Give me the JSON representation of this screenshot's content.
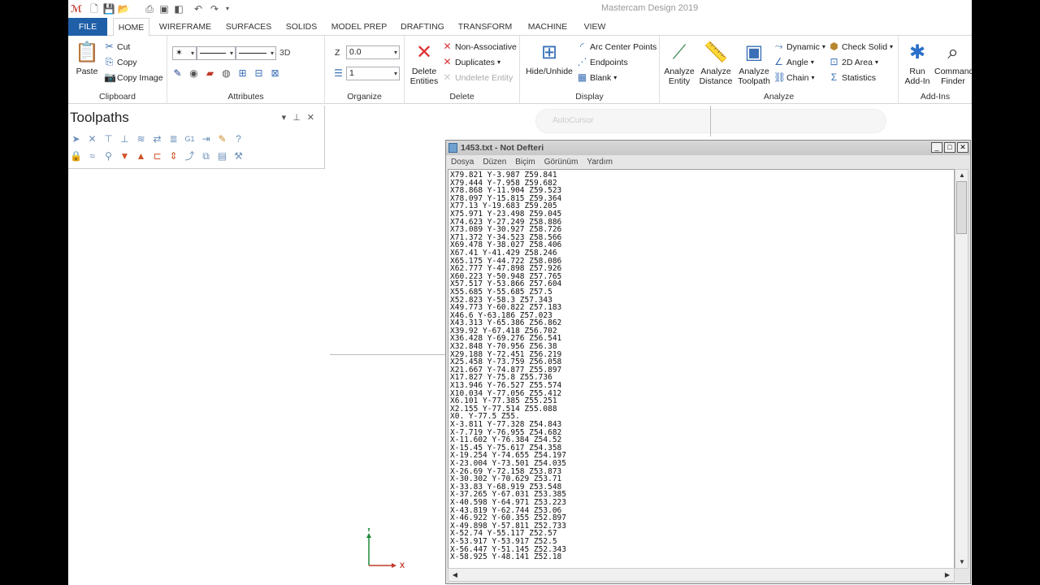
{
  "window": {
    "title": "Mastercam Design 2019"
  },
  "tabs": [
    {
      "label": "FILE"
    },
    {
      "label": "HOME"
    },
    {
      "label": "WIREFRAME"
    },
    {
      "label": "SURFACES"
    },
    {
      "label": "SOLIDS"
    },
    {
      "label": "MODEL PREP"
    },
    {
      "label": "DRAFTING"
    },
    {
      "label": "TRANSFORM"
    },
    {
      "label": "MACHINE"
    },
    {
      "label": "VIEW"
    }
  ],
  "ribbon": {
    "clipboard": {
      "label": "Clipboard",
      "paste": "Paste",
      "cut": "Cut",
      "copy": "Copy",
      "copy_image": "Copy Image"
    },
    "attributes": {
      "label": "Attributes",
      "mode_3d": "3D"
    },
    "organize": {
      "label": "Organize",
      "z_label": "Z",
      "z_value": "0.0",
      "level_value": "1"
    },
    "delete": {
      "label": "Delete",
      "delete_entities": "Delete Entities",
      "non_associative": "Non-Associative",
      "duplicates": "Duplicates",
      "undelete": "Undelete Entity"
    },
    "display": {
      "label": "Display",
      "hide_unhide": "Hide/Unhide",
      "arc_center_points": "Arc Center Points",
      "endpoints": "Endpoints",
      "blank": "Blank"
    },
    "analyze": {
      "label": "Analyze",
      "analyze_entity": "Analyze Entity",
      "analyze_distance": "Analyze Distance",
      "analyze_toolpath": "Analyze Toolpath",
      "dynamic": "Dynamic",
      "angle": "Angle",
      "chain": "Chain",
      "check_solid": "Check Solid",
      "area_2d": "2D Area",
      "statistics": "Statistics"
    },
    "addins": {
      "label": "Add-Ins",
      "run_addin": "Run Add-In",
      "command_finder": "Command Finder"
    }
  },
  "toolpaths": {
    "title": "Toolpaths"
  },
  "graphics": {
    "autocursor": "AutoCursor",
    "axis_y": "Y",
    "axis_x": "X"
  },
  "notepad": {
    "title": "1453.txt - Not Defteri",
    "menu": [
      "Dosya",
      "Düzen",
      "Biçim",
      "Görünüm",
      "Yardım"
    ],
    "lines": [
      "X79.821 Y-3.987 Z59.841",
      "X79.444 Y-7.958 Z59.682",
      "X78.868 Y-11.904 Z59.523",
      "X78.097 Y-15.815 Z59.364",
      "X77.13 Y-19.683 Z59.205",
      "X75.971 Y-23.498 Z59.045",
      "X74.623 Y-27.249 Z58.886",
      "X73.089 Y-30.927 Z58.726",
      "X71.372 Y-34.523 Z58.566",
      "X69.478 Y-38.027 Z58.406",
      "X67.41 Y-41.429 Z58.246",
      "X65.175 Y-44.722 Z58.086",
      "X62.777 Y-47.898 Z57.926",
      "X60.223 Y-50.948 Z57.765",
      "X57.517 Y-53.866 Z57.604",
      "X55.685 Y-55.685 Z57.5",
      "X52.823 Y-58.3 Z57.343",
      "X49.773 Y-60.822 Z57.183",
      "X46.6 Y-63.186 Z57.023",
      "X43.313 Y-65.386 Z56.862",
      "X39.92 Y-67.418 Z56.702",
      "X36.428 Y-69.276 Z56.541",
      "X32.848 Y-70.956 Z56.38",
      "X29.188 Y-72.451 Z56.219",
      "X25.458 Y-73.759 Z56.058",
      "X21.667 Y-74.877 Z55.897",
      "X17.827 Y-75.8 Z55.736",
      "X13.946 Y-76.527 Z55.574",
      "X10.034 Y-77.056 Z55.412",
      "X6.101 Y-77.385 Z55.251",
      "X2.155 Y-77.514 Z55.088",
      "X0. Y-77.5 Z55.",
      "X-3.811 Y-77.328 Z54.843",
      "X-7.719 Y-76.955 Z54.682",
      "X-11.602 Y-76.384 Z54.52",
      "X-15.45 Y-75.617 Z54.358",
      "X-19.254 Y-74.655 Z54.197",
      "X-23.004 Y-73.501 Z54.035",
      "X-26.69 Y-72.158 Z53.873",
      "X-30.302 Y-70.629 Z53.71",
      "X-33.83 Y-68.919 Z53.548",
      "X-37.265 Y-67.031 Z53.385",
      "X-40.598 Y-64.971 Z53.223",
      "X-43.819 Y-62.744 Z53.06",
      "X-46.922 Y-60.355 Z52.897",
      "X-49.898 Y-57.811 Z52.733",
      "X-52.74 Y-55.117 Z52.57",
      "X-53.917 Y-53.917 Z52.5",
      "X-56.447 Y-51.145 Z52.343",
      "X-58.925 Y-48.141 Z52.18"
    ]
  }
}
